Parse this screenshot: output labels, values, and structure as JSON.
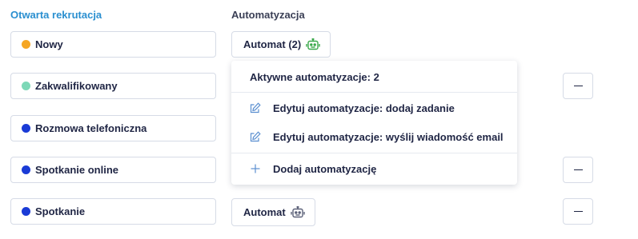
{
  "headers": {
    "left": "Otwarta rekrutacja",
    "right": "Automatyzacja"
  },
  "stages": [
    {
      "label": "Nowy",
      "color": "#f5a623"
    },
    {
      "label": "Zakwalifikowany",
      "color": "#7dd8b7"
    },
    {
      "label": "Rozmowa telefoniczna",
      "color": "#1a3bd6"
    },
    {
      "label": "Spotkanie online",
      "color": "#1a3bd6"
    },
    {
      "label": "Spotkanie",
      "color": "#1a3bd6"
    }
  ],
  "automation_buttons": [
    {
      "label": "Automat (2)",
      "icon": "robot-icon",
      "icon_color": "#39a84a"
    },
    {
      "label": "Automat",
      "icon": "robot-icon",
      "icon_color": "#5b6078"
    }
  ],
  "dropdown": {
    "title": "Aktywne automatyzacje: 2",
    "items": [
      {
        "label": "Edytuj automatyzacje: dodaj zadanie",
        "icon": "edit-icon"
      },
      {
        "label": "Edytuj automatyzacje: wyślij wiadomość email",
        "icon": "edit-icon"
      }
    ],
    "add_label": "Dodaj automatyzację",
    "add_icon": "plus-icon"
  },
  "remove_buttons": [
    {
      "icon": "minus-icon"
    },
    {
      "icon": "minus-icon"
    },
    {
      "icon": "minus-icon"
    }
  ],
  "colors": {
    "accent_blue": "#2a8fd0",
    "icon_blue": "#5b8fd0",
    "border": "#d6dbe6"
  }
}
